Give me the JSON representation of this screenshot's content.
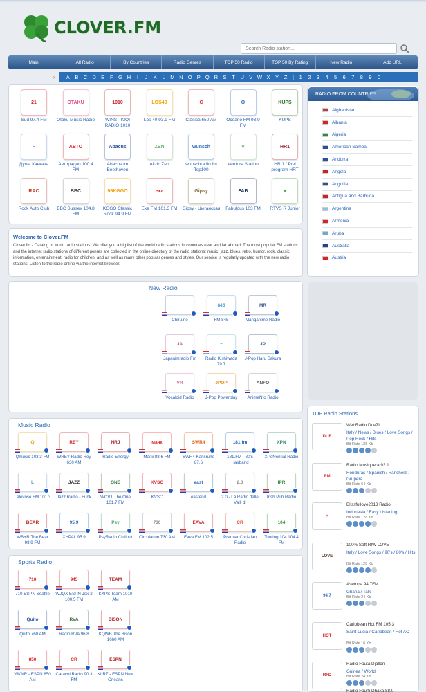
{
  "header": {
    "logo_text": "CLOVER.FM",
    "search_placeholder": "Search Radio station..."
  },
  "nav": [
    "Main",
    "All Radio",
    "By Countries",
    "Radio Genres",
    "TOP 50 Radio",
    "TOP 50 By Rating",
    "New Radio",
    "Add URL"
  ],
  "alphabet": [
    "A",
    "B",
    "C",
    "D",
    "E",
    "F",
    "G",
    "H",
    "I",
    "J",
    "K",
    "L",
    "M",
    "N",
    "O",
    "P",
    "Q",
    "R",
    "S",
    "T",
    "U",
    "V",
    "W",
    "X",
    "Y",
    "Z",
    "|",
    "1",
    "2",
    "3",
    "4",
    "5",
    "6",
    "7",
    "8",
    "9",
    "0"
  ],
  "top_stations": [
    {
      "name": "Sud 97.4 FM",
      "logo": "21",
      "color": "#d8262f"
    },
    {
      "name": "Otaku Music Radio",
      "logo": "OTAKU",
      "color": "#e0508a"
    },
    {
      "name": "WINS - KIQI RADIO 1010",
      "logo": "1010",
      "color": "#c0252a"
    },
    {
      "name": "Los 40 93.9 FM",
      "logo": "LOS40",
      "color": "#f4a300"
    },
    {
      "name": "Clásica 650 AM",
      "logo": "C",
      "color": "#d22b2b"
    },
    {
      "name": "Océano FM 93.9 FM",
      "logo": "O",
      "color": "#2a6ab4"
    },
    {
      "name": "KUPS",
      "logo": "KUPS",
      "color": "#2b7a2b"
    },
    {
      "name": "Душа Кавказа",
      "logo": "~",
      "color": "#5a8cc8"
    },
    {
      "name": "Авторадио 100.4 FM",
      "logo": "АВТО",
      "color": "#d8262f"
    },
    {
      "name": "Abacus.fm Beethoven",
      "logo": "Abacus",
      "color": "#2a4f9a"
    },
    {
      "name": "Allzic Zen",
      "logo": "ZEN",
      "color": "#7ab27a"
    },
    {
      "name": "wunschradio.fm Top100",
      "logo": "wunsch",
      "color": "#2a6ab4"
    },
    {
      "name": "Verdure Station",
      "logo": "V",
      "color": "#7ab27a"
    },
    {
      "name": "HR 1 / Prvi program HRT",
      "logo": "HR1",
      "color": "#a32130"
    },
    {
      "name": "Rock Auto Club",
      "logo": "RAC",
      "color": "#c03a20"
    },
    {
      "name": "BBC Sussex 104.8 FM",
      "logo": "BBC",
      "color": "#333"
    },
    {
      "name": "KGGO Classic Rock 94.9 FM",
      "logo": "95KGGO",
      "color": "#f29a00"
    },
    {
      "name": "Exa FM 101.3 FM",
      "logo": "exa",
      "color": "#d8262f"
    },
    {
      "name": "Gipsy - Цыганская",
      "logo": "Gipsy",
      "color": "#8a6b3c"
    },
    {
      "name": "Fabulous 103 FM",
      "logo": "FAB",
      "color": "#1e2f4f"
    },
    {
      "name": "RTVS R Junior",
      "logo": "♣",
      "color": "#3a9a3a"
    }
  ],
  "welcome": {
    "title": "Welcome to Clover.FM",
    "text": "Clover.fm - Catalog of world radio stations. We offer you a big list of the world radio stations in countries near and far abroad. The most popular FM stations and the internet radio stations of different genres are collected in the online directory of the radio stations: music, jazz, blues, retro, humor, rock, classic, information, entertainment, radio for children, and as well as many other popular genres and styles. Our service is regularly updated with the new radio stations. Listen to the radio online via the internet browser."
  },
  "new_radio": {
    "title": "New Radio",
    "items": [
      {
        "name": "Chiru.no",
        "logo": "",
        "color": "#4a7fb0"
      },
      {
        "name": "FM 845",
        "logo": "845",
        "color": "#4aa0d8"
      },
      {
        "name": "Manganime Radio",
        "logo": "MR",
        "color": "#3a5a90"
      },
      {
        "name": "Japanimradio Fm",
        "logo": "JA",
        "color": "#b06090"
      },
      {
        "name": "Radio Kishiwada 79.7",
        "logo": "~",
        "color": "#6aaad8"
      },
      {
        "name": "J-Pop Haru Sakura",
        "logo": "JP",
        "color": "#2a4f7a"
      },
      {
        "name": "Vocaloid Radio",
        "logo": "VR",
        "color": "#d070a0"
      },
      {
        "name": "J-Pop Powerplay",
        "logo": "JPOP",
        "color": "#e8881a"
      },
      {
        "name": "AnimeNfo Radio",
        "logo": "ANFO",
        "color": "#555"
      }
    ]
  },
  "music_radio": {
    "title": "Music Radio",
    "items": [
      {
        "name": "Qmusic 103.3 FM",
        "logo": "Q",
        "color": "#e2a21a"
      },
      {
        "name": "WREY Radio Rey 630 AM",
        "logo": "REY",
        "color": "#d8262f"
      },
      {
        "name": "Radio Energy",
        "logo": "NRJ",
        "color": "#b02030"
      },
      {
        "name": "Маяк 88.6 FM",
        "logo": "маяк",
        "color": "#e03030"
      },
      {
        "name": "SWR4 Karlsruhe 87.6",
        "logo": "SWR4",
        "color": "#e05a10"
      },
      {
        "name": "181.FM - 80's Hairband",
        "logo": "181.fm",
        "color": "#2a6ab4"
      },
      {
        "name": "XPoNential Radio",
        "logo": "XPN",
        "color": "#3a8a6a"
      },
      {
        "name": "Lelevose FM 101.3",
        "logo": "L",
        "color": "#5a9ad8"
      },
      {
        "name": "Jazz Radio - Funk",
        "logo": "JAZZ",
        "color": "#333"
      },
      {
        "name": "WCVT The One 101.7 FM",
        "logo": "ONE",
        "color": "#3a7a3a"
      },
      {
        "name": "KVSC",
        "logo": "KVSC",
        "color": "#d8262f"
      },
      {
        "name": "eastend",
        "logo": "east",
        "color": "#2a6ab4"
      },
      {
        "name": "2.0 - La Radio delle Valli di",
        "logo": "2.0",
        "color": "#888"
      },
      {
        "name": "Irish Pub Radio",
        "logo": "IPR",
        "color": "#3a8a3a"
      },
      {
        "name": "WBYR The Bear 98.9 FM",
        "logo": "BEAR",
        "color": "#c02020"
      },
      {
        "name": "XHPAL 95.9",
        "logo": "95.9",
        "color": "#2a6ab4"
      },
      {
        "name": "PsyRadio Chillout",
        "logo": "Psy",
        "color": "#3aaa6a"
      },
      {
        "name": "Circulation 730 AM",
        "logo": "730",
        "color": "#888"
      },
      {
        "name": "Eava FM 102.5",
        "logo": "EAVA",
        "color": "#d8262f"
      },
      {
        "name": "Premier Christian Radio",
        "logo": "CR",
        "color": "#e04a20"
      },
      {
        "name": "Touring 104 104.4 FM",
        "logo": "104",
        "color": "#3a8a3a"
      }
    ]
  },
  "sports_radio": {
    "title": "Sports Radio",
    "items": [
      {
        "name": "710 ESPN Seattle",
        "logo": "710",
        "color": "#d8262f"
      },
      {
        "name": "WJQX ESPN Jox-2 100.5 FM",
        "logo": "945",
        "color": "#d8262f"
      },
      {
        "name": "KXPS Team 1010 AM",
        "logo": "TEAM",
        "color": "#b02020"
      },
      {
        "name": "Quito 760 AM",
        "logo": "Quito",
        "color": "#2a4f9a"
      },
      {
        "name": "Radio RVA 96.8",
        "logo": "RVA",
        "color": "#3a6a3a"
      },
      {
        "name": "KQWB The Bison 1660 AM",
        "logo": "BISON",
        "color": "#b02020"
      },
      {
        "name": "WKNR - ESPN 850 AM",
        "logo": "850",
        "color": "#d8262f"
      },
      {
        "name": "Caracol Radio 90.3 FM",
        "logo": "CR",
        "color": "#d8262f"
      },
      {
        "name": "KLRZ - ESPN New Orleans",
        "logo": "ESPN",
        "color": "#b02020"
      }
    ]
  },
  "countries": {
    "title": "RADIO FROM COUNTRIES",
    "items": [
      "Afghanistan",
      "Albania",
      "Algeria",
      "American Samoa",
      "Andorra",
      "Angola",
      "Anguilla",
      "Antigua and Barbuda",
      "Argentina",
      "Armenia",
      "Aruba",
      "Australia",
      "Austria"
    ]
  },
  "top_radio": {
    "title": "TOP Radio Stations",
    "items": [
      {
        "name": "WebRadio DueZil",
        "genre": "Italy / News / Blues / Love Songs / Pop Rock / Hits",
        "rate": "Bit Rate 128 Kb",
        "stars": 4,
        "logo": "DUE",
        "color": "#d8262f"
      },
      {
        "name": "Radio Musiquera 93.1",
        "genre": "Honduras / Spanish / Ranchera / Grupera",
        "rate": "Bit Rate 64 Kb",
        "stars": 3,
        "logo": "RM",
        "color": "#d8262f"
      },
      {
        "name": "Blissfullove2013 Radio",
        "genre": "Indonesia / Easy Listening",
        "rate": "Bit Rate 128 Kb",
        "stars": 4,
        "logo": "♥",
        "color": "#d88a8a"
      },
      {
        "name": "100% Soft RIW LOVE",
        "genre": "Italy / Love Songs / 90's / 80's / Hits",
        "rate": "Bit Rate 128 Kb",
        "stars": 4,
        "logo": "LOVE",
        "color": "#4a3a20"
      },
      {
        "name": "Asempa 94.7FM",
        "genre": "Ghana / Talk",
        "rate": "Bit Rate 24 Kb",
        "stars": 3,
        "logo": "94.7",
        "color": "#2a6ab4"
      },
      {
        "name": "Caribbean Hot FM 105.3",
        "genre": "Saint Lucia / Caribbean / Hot AC",
        "rate": "Bit Rate 16 Kb",
        "stars": 3,
        "logo": "HOT",
        "color": "#d8262f"
      },
      {
        "name": "Radio Fouta Djallon",
        "genre": "Guinea / World",
        "rate": "Bit Rate 24 Kb",
        "stars": 3,
        "logo": "RFD",
        "color": "#c02020"
      }
    ],
    "partial_name": "Radio Fourti Dhaka 88.0"
  }
}
